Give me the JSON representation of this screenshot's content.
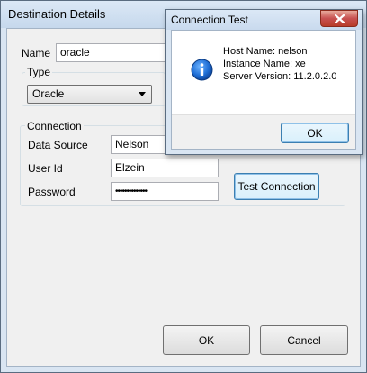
{
  "main_dialog": {
    "title": "Destination Details",
    "name_label": "Name",
    "name_value": "oracle",
    "type_group_title": "Type",
    "type_selected": "Oracle",
    "connection_group_title": "Connection",
    "data_source_label": "Data Source",
    "data_source_value": "Nelson",
    "user_id_label": "User Id",
    "user_id_value": "Elzein",
    "password_label": "Password",
    "password_value": "••••••••••••••",
    "test_connection_label": "Test Connection",
    "ok_label": "OK",
    "cancel_label": "Cancel"
  },
  "connection_test": {
    "title": "Connection Test",
    "host_line": "Host Name: nelson",
    "instance_line": "Instance Name: xe",
    "server_line": "Server Version: 11.2.0.2.0",
    "ok_label": "OK",
    "icon": "info-icon"
  }
}
